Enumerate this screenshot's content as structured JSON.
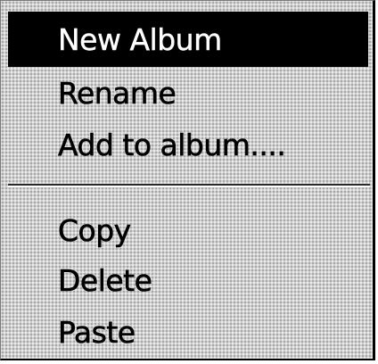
{
  "context_menu": {
    "group1": [
      {
        "label": "New Album"
      },
      {
        "label": "Rename"
      },
      {
        "label": "Add to album...."
      }
    ],
    "group2": [
      {
        "label": "Copy"
      },
      {
        "label": "Delete"
      },
      {
        "label": "Paste"
      }
    ],
    "highlighted_item": "New Album",
    "colors": {
      "highlight_bg": "#000000",
      "highlight_text": "#ffffff",
      "text": "#000000"
    }
  }
}
